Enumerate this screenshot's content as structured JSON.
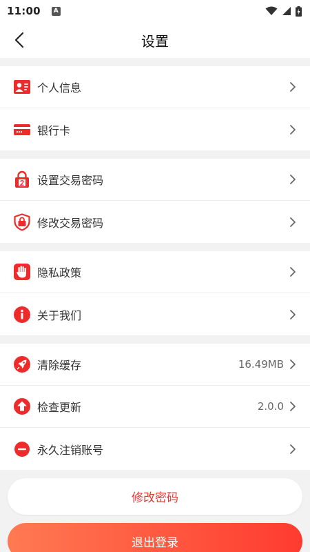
{
  "status_bar": {
    "time": "11:00",
    "notification_letter": "A"
  },
  "header": {
    "title": "设置"
  },
  "groups": [
    {
      "items": [
        {
          "label": "个人信息",
          "icon": "id-card-icon"
        },
        {
          "label": "银行卡",
          "icon": "bank-card-icon"
        }
      ]
    },
    {
      "items": [
        {
          "label": "设置交易密码",
          "icon": "padlock-icon"
        },
        {
          "label": "修改交易密码",
          "icon": "shield-lock-icon"
        }
      ]
    },
    {
      "items": [
        {
          "label": "隐私政策",
          "icon": "hand-icon"
        },
        {
          "label": "关于我们",
          "icon": "info-icon"
        }
      ]
    },
    {
      "items": [
        {
          "label": "清除缓存",
          "icon": "rocket-icon",
          "value": "16.49MB"
        },
        {
          "label": "检查更新",
          "icon": "upload-arrow-icon",
          "value": "2.0.0"
        },
        {
          "label": "永久注销账号",
          "icon": "minus-circle-icon"
        }
      ]
    }
  ],
  "buttons": {
    "change_password": "修改密码",
    "logout": "退出登录"
  },
  "colors": {
    "accent": "#e83a35",
    "icon_red": "#ee2b2b",
    "gradient_start": "#ff7a52",
    "gradient_end": "#ff3b30",
    "background": "#f2f2f2"
  }
}
